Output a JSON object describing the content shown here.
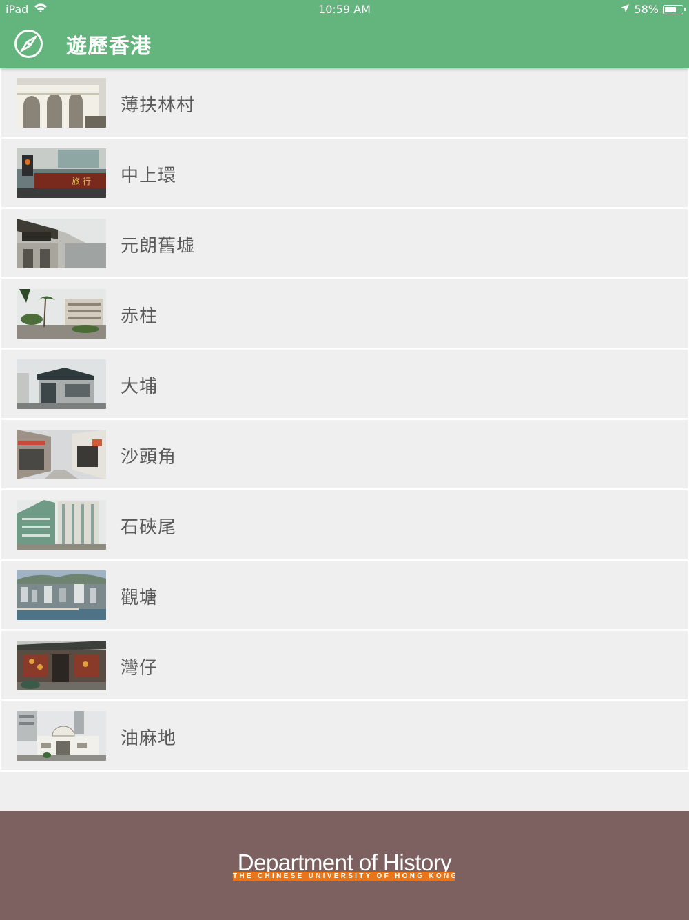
{
  "status_bar": {
    "device": "iPad",
    "time": "10:59 AM",
    "battery": "58%",
    "battery_level": 0.58
  },
  "header": {
    "icon": "compass-icon",
    "title": "遊歷香港",
    "color": "#64b57d"
  },
  "places": [
    {
      "label": "薄扶林村",
      "thumb": "white-arched-building"
    },
    {
      "label": "中上環",
      "thumb": "street-signboard"
    },
    {
      "label": "元朗舊墟",
      "thumb": "old-shop-front"
    },
    {
      "label": "赤柱",
      "thumb": "palm-promenade"
    },
    {
      "label": "大埔",
      "thumb": "temple-building"
    },
    {
      "label": "沙頭角",
      "thumb": "street-shops"
    },
    {
      "label": "石硤尾",
      "thumb": "housing-estate"
    },
    {
      "label": "觀塘",
      "thumb": "city-aerial"
    },
    {
      "label": "灣仔",
      "thumb": "temple-interior"
    },
    {
      "label": "油麻地",
      "thumb": "theatre-building"
    }
  ],
  "footer": {
    "department": "Department of History",
    "university": "THE CHINESE UNIVERSITY OF HONG KONG",
    "color": "#7d6060",
    "accent": "#e8751a"
  }
}
